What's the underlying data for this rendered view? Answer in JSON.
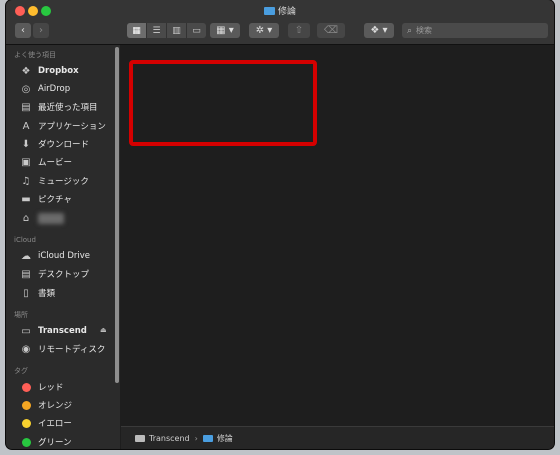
{
  "window": {
    "title": "修論"
  },
  "toolbar": {
    "back": "‹",
    "forward": "›",
    "view_icons": "▦",
    "view_list": "☰",
    "view_columns": "▥",
    "view_gallery": "▭",
    "group_menu": "▦ ▾",
    "action_menu": "✲ ▾",
    "share": "⇧",
    "tag": "⌫",
    "dropbox_menu": "❖ ▾",
    "search_placeholder": "検索"
  },
  "sidebar": {
    "favorites_header": "よく使う項目",
    "favorites": [
      {
        "label": "Dropbox",
        "icon": "dropbox-icon",
        "glyph": "❖"
      },
      {
        "label": "AirDrop",
        "icon": "airdrop-icon",
        "glyph": "◎"
      },
      {
        "label": "最近使った項目",
        "icon": "recents-icon",
        "glyph": "▤"
      },
      {
        "label": "アプリケーション",
        "icon": "applications-icon",
        "glyph": "A"
      },
      {
        "label": "ダウンロード",
        "icon": "downloads-icon",
        "glyph": "⬇"
      },
      {
        "label": "ムービー",
        "icon": "movies-icon",
        "glyph": "▣"
      },
      {
        "label": "ミュージック",
        "icon": "music-icon",
        "glyph": "♫"
      },
      {
        "label": "ピクチャ",
        "icon": "pictures-icon",
        "glyph": "▬"
      },
      {
        "label": "",
        "icon": "home-icon",
        "glyph": "⌂"
      }
    ],
    "icloud_header": "iCloud",
    "icloud": [
      {
        "label": "iCloud Drive",
        "icon": "icloud-drive-icon",
        "glyph": "☁"
      },
      {
        "label": "デスクトップ",
        "icon": "desktop-icon",
        "glyph": "▤"
      },
      {
        "label": "書類",
        "icon": "documents-icon",
        "glyph": "▯"
      }
    ],
    "locations_header": "場所",
    "locations": [
      {
        "label": "Transcend",
        "icon": "drive-icon",
        "glyph": "▭"
      },
      {
        "label": "リモートディスク",
        "icon": "remote-disc-icon",
        "glyph": "◉"
      }
    ],
    "tags_header": "タグ",
    "tags": [
      {
        "label": "レッド",
        "color": "#ff5f57"
      },
      {
        "label": "オレンジ",
        "color": "#f5a623"
      },
      {
        "label": "イエロー",
        "color": "#f8d12f"
      },
      {
        "label": "グリーン",
        "color": "#28c840"
      }
    ]
  },
  "pathbar": {
    "drive": "Transcend",
    "separator": "›",
    "folder": "修論"
  },
  "colors": {
    "highlight": "#d40000",
    "folder": "#4a9ee0"
  }
}
